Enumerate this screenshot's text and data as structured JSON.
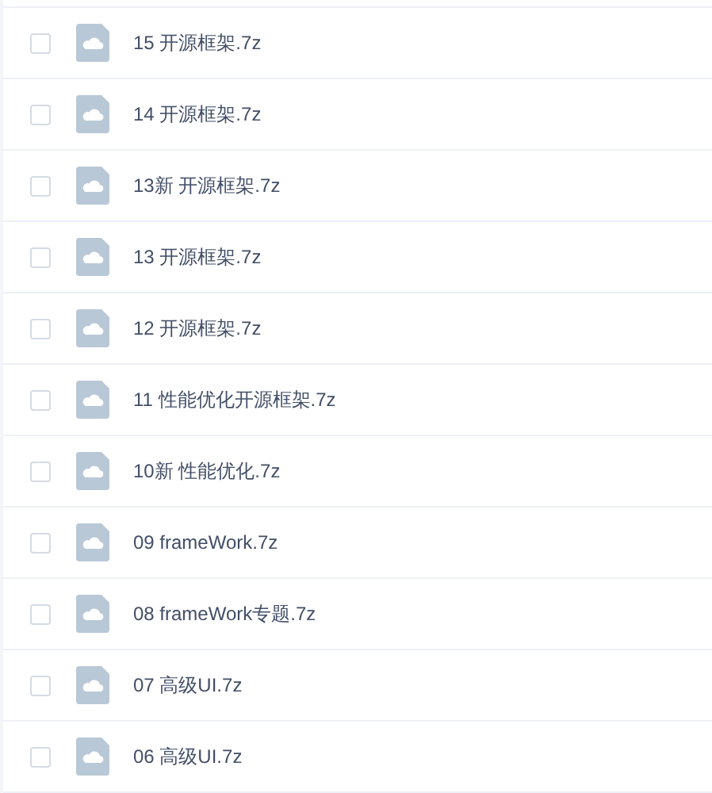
{
  "files": [
    {
      "name": "15 开源框架.7z",
      "checked": false
    },
    {
      "name": "14 开源框架.7z",
      "checked": false
    },
    {
      "name": "13新 开源框架.7z",
      "checked": false
    },
    {
      "name": "13 开源框架.7z",
      "checked": false
    },
    {
      "name": "12 开源框架.7z",
      "checked": false
    },
    {
      "name": "11 性能优化开源框架.7z",
      "checked": false
    },
    {
      "name": "10新 性能优化.7z",
      "checked": false
    },
    {
      "name": "09 frameWork.7z",
      "checked": false
    },
    {
      "name": "08 frameWork专题.7z",
      "checked": false
    },
    {
      "name": "07 高级UI.7z",
      "checked": false
    },
    {
      "name": "06 高级UI.7z",
      "checked": false
    }
  ]
}
